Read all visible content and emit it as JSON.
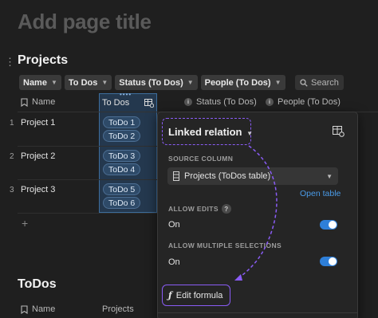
{
  "page": {
    "title": "Add page title"
  },
  "database": {
    "title": "Projects",
    "filters": [
      {
        "label": "Name"
      },
      {
        "label": "To Dos"
      },
      {
        "label": "Status (To Dos)"
      },
      {
        "label": "People (To Dos)"
      }
    ],
    "search_label": "Search",
    "columns": {
      "name": "Name",
      "todos": "To Dos",
      "status": "Status (To Dos)",
      "people": "People (To Dos)"
    },
    "rows": [
      {
        "num": "1",
        "name": "Project 1",
        "todos": [
          "ToDo 1",
          "ToDo 2"
        ]
      },
      {
        "num": "2",
        "name": "Project 2",
        "todos": [
          "ToDo 3",
          "ToDo 4"
        ]
      },
      {
        "num": "3",
        "name": "Project 3",
        "todos": [
          "ToDo 5",
          "ToDo 6"
        ]
      }
    ],
    "add_row": "+"
  },
  "section2": {
    "title": "ToDos",
    "columns": {
      "name": "Name",
      "projects": "Projects"
    }
  },
  "panel": {
    "title": "Linked relation",
    "source_label": "SOURCE COLUMN",
    "source_value": "Projects (ToDos table)",
    "open_table": "Open table",
    "allow_edits_label": "ALLOW EDITS",
    "allow_edits_help": "?",
    "allow_edits_value": "On",
    "allow_multi_label": "ALLOW MULTIPLE SELECTIONS",
    "allow_multi_value": "On",
    "edit_formula": "Edit formula",
    "formula_glyph": "ƒ"
  },
  "colors": {
    "accent_purple": "#8a5cf6",
    "toggle_blue": "#2e7fd9",
    "link_blue": "#4a9be8",
    "tag_bg": "#2e4a68",
    "selected_col_bg": "#24384e"
  }
}
